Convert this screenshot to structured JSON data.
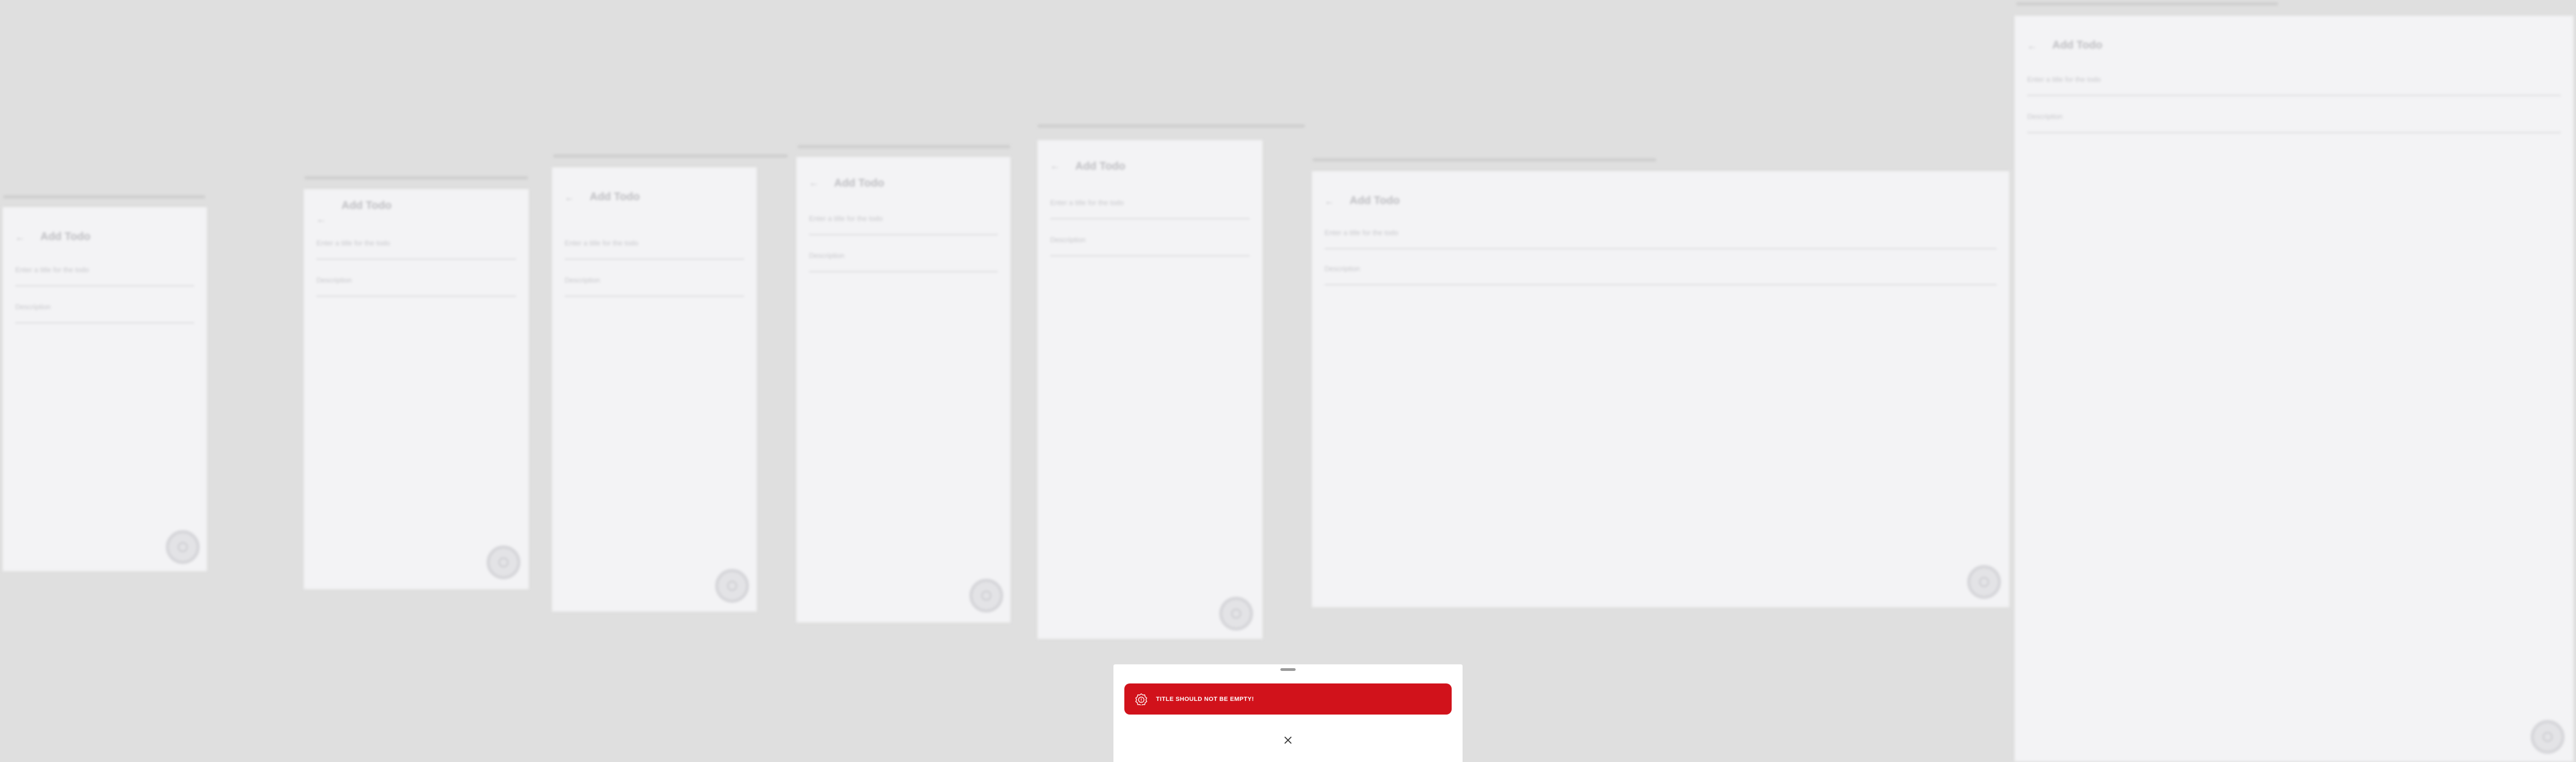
{
  "screens": [
    {
      "title": "Add Todo",
      "title_field_label": "Enter a title for the todo",
      "description_field_label": "Description"
    },
    {
      "title": "Add Todo",
      "title_field_label": "Enter a title for the todo",
      "description_field_label": "Description"
    },
    {
      "title": "Add Todo",
      "title_field_label": "Enter a title for the todo",
      "description_field_label": "Description"
    },
    {
      "title": "Add Todo",
      "title_field_label": "Enter a title for the todo",
      "description_field_label": "Description"
    },
    {
      "title": "Add Todo",
      "title_field_label": "Enter a title for the todo",
      "description_field_label": "Description"
    },
    {
      "title": "Add Todo",
      "title_field_label": "Enter a title for the todo",
      "description_field_label": "Description"
    },
    {
      "title": "Add Todo",
      "title_field_label": "Enter a title for the todo",
      "description_field_label": "Description"
    }
  ],
  "snackbar": {
    "message": "TITLE SHOULD NOT BE EMPTY!",
    "background_color": "#d1121b",
    "icon": "error-badge-icon"
  },
  "sheet": {
    "close_icon": "close-icon"
  }
}
